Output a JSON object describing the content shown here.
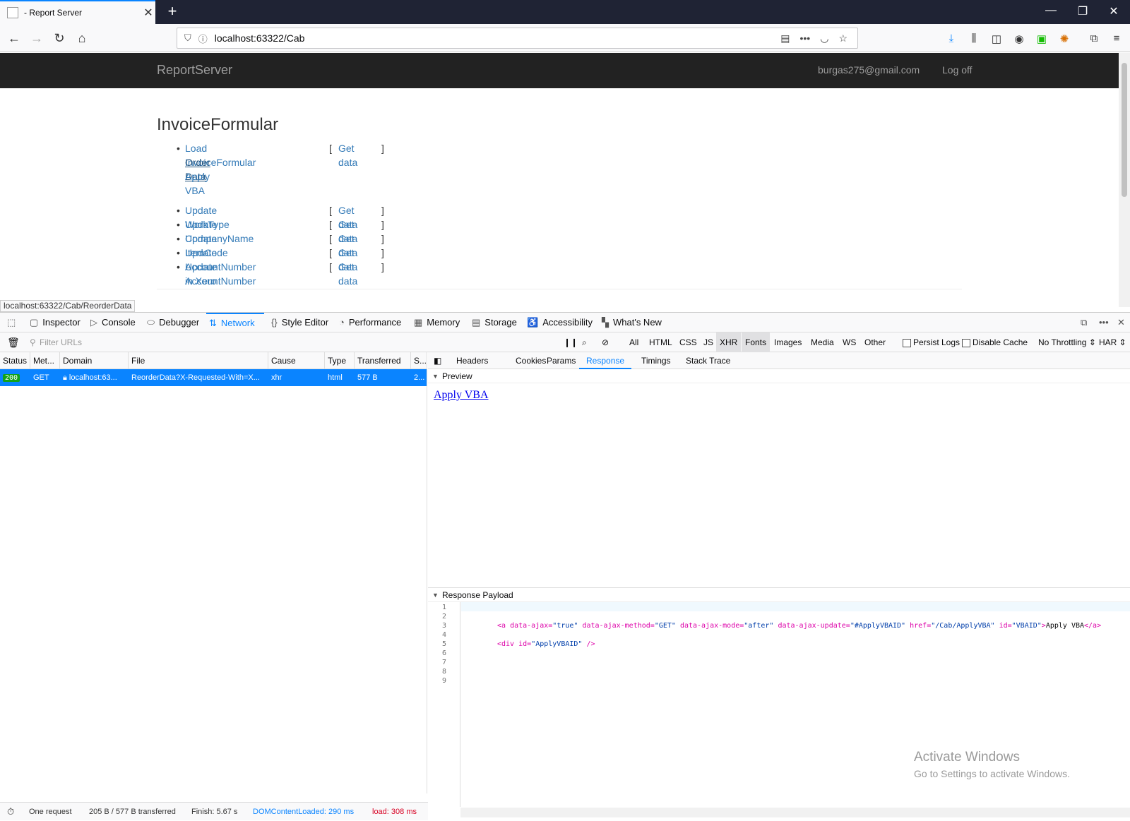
{
  "browser": {
    "tab_title": "- Report Server",
    "url": "localhost:63322/Cab",
    "status_url": "localhost:63322/Cab/ReorderData"
  },
  "site": {
    "brand": "ReportServer",
    "user_email": "burgas275@gmail.com",
    "logoff": "Log off",
    "page_title": "InvoiceFormular",
    "group1": [
      {
        "label": "Load InvoiceFormular",
        "get": "Get data"
      },
      {
        "label": "Order Data",
        "get": ""
      },
      {
        "label": "Apply VBA",
        "get": ""
      }
    ],
    "group2": [
      {
        "label": "Update WorkType",
        "get": "Get data"
      },
      {
        "label": "Update CompanyName",
        "get": "Get data"
      },
      {
        "label": "Update ItemCode",
        "get": "Get data"
      },
      {
        "label": "Update AccountNumber in Xero",
        "get": "Get data"
      },
      {
        "label": "Update AccountNumber",
        "get": "Get data"
      }
    ]
  },
  "devtools": {
    "tabs": [
      "Inspector",
      "Console",
      "Debugger",
      "Network",
      "Style Editor",
      "Performance",
      "Memory",
      "Storage",
      "Accessibility",
      "What's New"
    ],
    "filter_placeholder": "Filter URLs",
    "type_filters": [
      "All",
      "HTML",
      "CSS",
      "JS",
      "XHR",
      "Fonts",
      "Images",
      "Media",
      "WS",
      "Other"
    ],
    "persist_logs": "Persist Logs",
    "disable_cache": "Disable Cache",
    "throttling": "No Throttling ⇕",
    "har": "HAR ⇕",
    "columns": [
      "Status",
      "Met...",
      "Domain",
      "File",
      "Cause",
      "Type",
      "Transferred",
      "S..."
    ],
    "request": {
      "status": "200",
      "method": "GET",
      "domain": "localhost:63...",
      "file": "ReorderData?X-Requested-With=X...",
      "cause": "xhr",
      "type": "html",
      "transferred": "577 B",
      "size": "2..."
    },
    "detail_tabs": [
      "Headers",
      "Cookies",
      "Params",
      "Response",
      "Timings",
      "Stack Trace"
    ],
    "preview_label": "Preview",
    "preview_link": "Apply VBA",
    "payload_label": "Response Payload",
    "line_numbers": [
      "1",
      "2",
      "3",
      "4",
      "5",
      "6",
      "7",
      "8",
      "9"
    ],
    "code": {
      "line3": {
        "open": "<a",
        "a1": "data-ajax=",
        "v1": "\"true\"",
        "a2": "data-ajax-method=",
        "v2": "\"GET\"",
        "a3": "data-ajax-mode=",
        "v3": "\"after\"",
        "a4": "data-ajax-update=",
        "v4": "\"#ApplyVBAID\"",
        "a5": "href=",
        "v5": "\"/Cab/ApplyVBA\"",
        "a6": "id=",
        "v6": "\"VBAID\"",
        "gt": ">",
        "text": "Apply VBA",
        "close": "</a>"
      },
      "line5": {
        "open": "<div",
        "a1": "id=",
        "v1": "\"ApplyVBAID\"",
        "close": "/>"
      }
    },
    "footer": {
      "requests": "One request",
      "transferred": "205 B / 577 B transferred",
      "finish": "Finish: 5.67 s",
      "domcontent": "DOMContentLoaded: 290 ms",
      "load": "load: 308 ms"
    }
  },
  "watermark": {
    "line1": "Activate Windows",
    "line2": "Go to Settings to activate Windows."
  },
  "colors": {
    "accent": "#0a84ff",
    "site_nav": "#222222",
    "link": "#337ab7",
    "status_ok": "#12a31b",
    "domcontent": "#0a84ff",
    "load": "#d70022"
  }
}
